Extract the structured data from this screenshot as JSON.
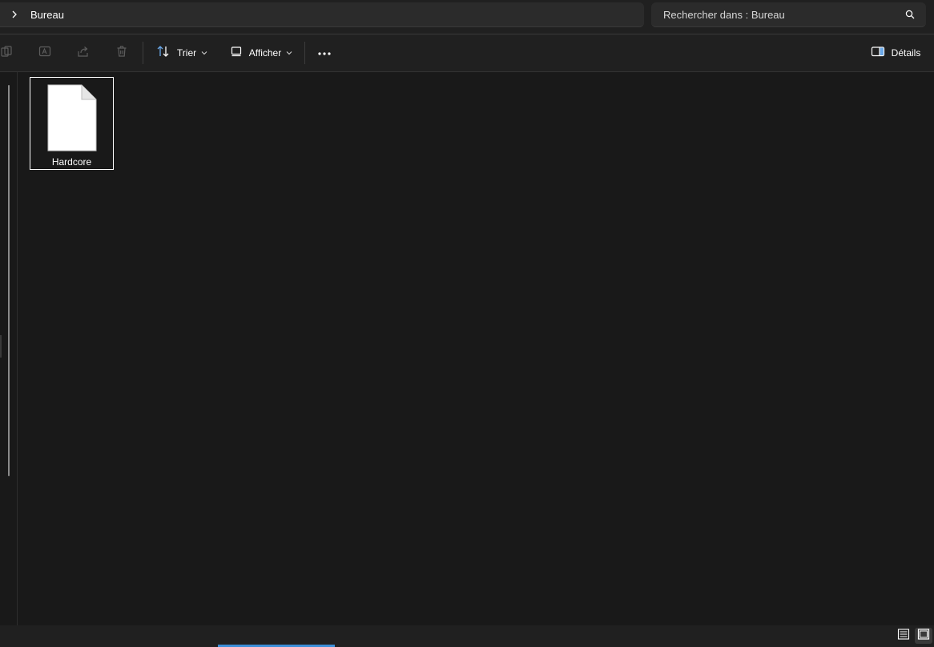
{
  "address": {
    "chevron_icon": "chevron-right-icon",
    "location": "Bureau"
  },
  "search": {
    "placeholder": "Rechercher dans : Bureau",
    "icon": "search-icon"
  },
  "toolbar": {
    "copy_icon": "copy-icon",
    "rename_icon": "rename-icon",
    "share_icon": "share-icon",
    "delete_icon": "trash-icon",
    "sort_label": "Trier",
    "view_label": "Afficher",
    "more_icon": "more-horizontal-icon",
    "details_label": "Détails"
  },
  "files": [
    {
      "name": "Hardcore",
      "icon": "document-icon",
      "selected": true
    }
  ],
  "statusbar": {
    "details_view_icon": "details-view-icon",
    "large_icons_view_icon": "large-icons-view-icon",
    "active_view": "large-icons"
  },
  "colors": {
    "background": "#191919",
    "toolbar": "#202020",
    "input": "#2b2b2b",
    "accent": "#3b8ed8",
    "text": "#ffffff"
  }
}
